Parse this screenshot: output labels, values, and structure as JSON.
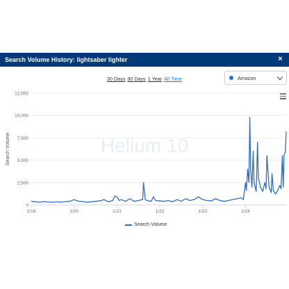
{
  "header": {
    "title": "Search Volume History: lightsaber lighter",
    "close_label": "×"
  },
  "ranges": [
    {
      "label": "30 Days",
      "active": false
    },
    {
      "label": "90 Days",
      "active": false
    },
    {
      "label": "1 Year",
      "active": false
    },
    {
      "label": "All Time",
      "active": true
    }
  ],
  "marketplace": {
    "selected": "Amazon",
    "dot_color": "#1a73e8"
  },
  "watermark": {
    "text": "Helium 10"
  },
  "colors": {
    "header_bg": "#033a7a",
    "series": "#2f6cc0",
    "active_link": "#2a7ce0"
  },
  "chart_data": {
    "type": "line",
    "title": "",
    "xlabel": "",
    "ylabel": "Search Volume",
    "ylim": [
      0,
      12500
    ],
    "yticks": [
      0,
      2500,
      5000,
      7500,
      10000,
      12500
    ],
    "ytick_labels": [
      "0",
      "2,500",
      "5,000",
      "7,500",
      "10,000",
      "12,500"
    ],
    "xlim": [
      2019.0,
      2024.95
    ],
    "xticks": [
      2019,
      2020,
      2021,
      2022,
      2023,
      2024
    ],
    "xtick_labels": [
      "1/19",
      "1/20",
      "1/21",
      "1/22",
      "1/23",
      "1/24"
    ],
    "grid": true,
    "legend": "bottom",
    "series": [
      {
        "name": "Search Volume",
        "x": [
          2019.0,
          2019.1,
          2019.2,
          2019.3,
          2019.4,
          2019.5,
          2019.6,
          2019.7,
          2019.8,
          2019.9,
          2020.0,
          2020.05,
          2020.1,
          2020.2,
          2020.3,
          2020.4,
          2020.5,
          2020.6,
          2020.7,
          2020.8,
          2020.9,
          2020.95,
          2021.0,
          2021.05,
          2021.1,
          2021.2,
          2021.3,
          2021.4,
          2021.5,
          2021.6,
          2021.62,
          2021.66,
          2021.7,
          2021.8,
          2021.85,
          2021.9,
          2022.0,
          2022.1,
          2022.2,
          2022.3,
          2022.4,
          2022.5,
          2022.6,
          2022.7,
          2022.8,
          2022.9,
          2023.0,
          2023.1,
          2023.2,
          2023.3,
          2023.4,
          2023.5,
          2023.6,
          2023.7,
          2023.8,
          2023.9,
          2023.95,
          2024.0,
          2024.02,
          2024.05,
          2024.08,
          2024.1,
          2024.12,
          2024.15,
          2024.18,
          2024.2,
          2024.25,
          2024.28,
          2024.3,
          2024.35,
          2024.4,
          2024.45,
          2024.48,
          2024.5,
          2024.55,
          2024.6,
          2024.62,
          2024.65,
          2024.7,
          2024.75,
          2024.8,
          2024.83,
          2024.86,
          2024.88,
          2024.9,
          2024.93,
          2024.95
        ],
        "values": [
          400,
          350,
          300,
          380,
          320,
          300,
          350,
          300,
          380,
          400,
          600,
          500,
          420,
          380,
          300,
          350,
          400,
          450,
          600,
          350,
          500,
          1000,
          900,
          500,
          600,
          400,
          700,
          400,
          500,
          600,
          2500,
          600,
          500,
          400,
          900,
          500,
          450,
          400,
          500,
          350,
          600,
          400,
          700,
          500,
          600,
          900,
          600,
          500,
          450,
          700,
          500,
          400,
          500,
          600,
          700,
          800,
          600,
          2500,
          1600,
          4000,
          2500,
          9800,
          4000,
          2000,
          6000,
          2500,
          1500,
          7000,
          3000,
          2000,
          1500,
          2500,
          1800,
          5500,
          2000,
          1400,
          3500,
          1600,
          1200,
          1600,
          2200,
          1800,
          5500,
          2000,
          5500,
          6000,
          8200
        ]
      }
    ]
  }
}
